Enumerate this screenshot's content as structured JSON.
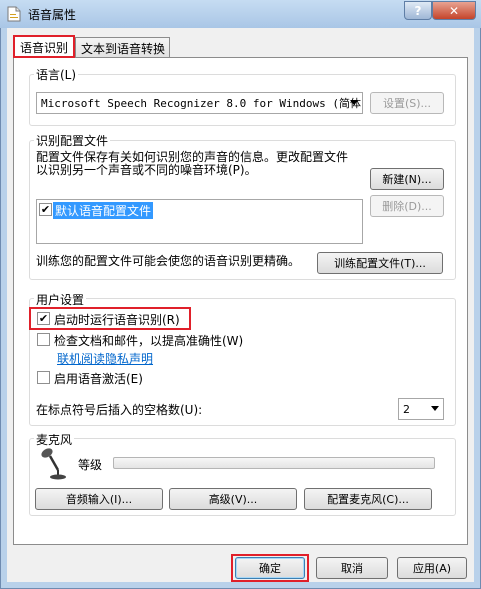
{
  "window": {
    "title": "语音属性",
    "help_label": "?",
    "close_label": "✕"
  },
  "tabs": [
    {
      "label": "语音识别",
      "active": true
    },
    {
      "label": "文本到语音转换",
      "active": false
    }
  ],
  "language": {
    "group_label": "语言(L)",
    "selected": "Microsoft Speech Recognizer 8.0 for Windows (简体中",
    "settings_button": "设置(S)..."
  },
  "profiles": {
    "group_label": "识别配置文件",
    "description_line1": "配置文件保存有关如何识别您的声音的信息。更改配置文件",
    "description_line2": "以识别另一个声音或不同的噪音环境(P)。",
    "new_button": "新建(N)...",
    "delete_button": "删除(D)...",
    "items": [
      {
        "label": "默认语音配置文件",
        "checked": true
      }
    ],
    "train_text": "训练您的配置文件可能会使您的语音识别更精确。",
    "train_button": "训练配置文件(T)..."
  },
  "user_settings": {
    "group_label": "用户设置",
    "run_at_startup": {
      "label": "启动时运行语音识别(R)",
      "checked": true
    },
    "review_docs": {
      "label": "检查文档和邮件，以提高准确性(W)",
      "checked": false
    },
    "privacy_link": "联机阅读隐私声明",
    "voice_activation": {
      "label": "启用语音激活(E)",
      "checked": false
    },
    "spaces_label": "在标点符号后插入的空格数(U):",
    "spaces_value": "2"
  },
  "microphone": {
    "group_label": "麦克风",
    "level_label": "等级",
    "level": 0,
    "audio_input_button": "音频输入(I)...",
    "advanced_button": "高级(V)...",
    "configure_button": "配置麦克风(C)..."
  },
  "footer": {
    "ok": "确定",
    "cancel": "取消",
    "apply": "应用(A)"
  }
}
